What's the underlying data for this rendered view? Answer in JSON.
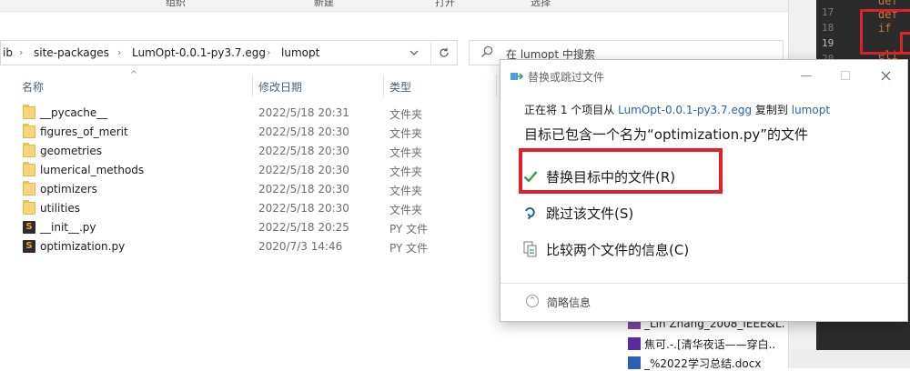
{
  "ribbon": {
    "items": [
      "组织",
      "新建",
      "打开",
      "选择"
    ]
  },
  "address": {
    "crumbs": [
      "ib",
      "site-packages",
      "LumOpt-0.0.1-py3.7.egg",
      "lumopt"
    ],
    "refresh_icon": "refresh-icon",
    "dropdown_icon": "chevron-down-icon"
  },
  "search": {
    "placeholder": "在 lumopt 中搜索",
    "icon": "search-icon"
  },
  "columns": {
    "name": "名称",
    "date": "修改日期",
    "type": "类型"
  },
  "files": [
    {
      "name": "__pycache__",
      "date": "2022/5/18 20:31",
      "type": "文件夹",
      "kind": "folder"
    },
    {
      "name": "figures_of_merit",
      "date": "2022/5/18 20:30",
      "type": "文件夹",
      "kind": "folder"
    },
    {
      "name": "geometries",
      "date": "2022/5/18 20:30",
      "type": "文件夹",
      "kind": "folder"
    },
    {
      "name": "lumerical_methods",
      "date": "2022/5/18 20:30",
      "type": "文件夹",
      "kind": "folder"
    },
    {
      "name": "optimizers",
      "date": "2022/5/18 20:30",
      "type": "文件夹",
      "kind": "folder"
    },
    {
      "name": "utilities",
      "date": "2022/5/18 20:30",
      "type": "文件夹",
      "kind": "folder"
    },
    {
      "name": "__init__.py",
      "date": "2022/5/18 20:25",
      "type": "PY 文件",
      "kind": "py"
    },
    {
      "name": "optimization.py",
      "date": "2020/7/3 14:46",
      "type": "PY 文件",
      "kind": "py"
    }
  ],
  "editor": {
    "lines": [
      "17",
      "18",
      "19",
      "20"
    ],
    "tokens": [
      "def",
      "def",
      "if",
      "eli"
    ]
  },
  "background_list": [
    "_Lin Zhang_2008_IEEE&L.",
    "焦可.-.[清华夜话——穿白..",
    "_%2022学习总结.docx"
  ],
  "dialog": {
    "title": "替换或跳过文件",
    "info_prefix": "正在将 1 个项目从",
    "info_source": "LumOpt-0.0.1-py3.7.egg",
    "info_mid": "复制到",
    "info_dest": "lumopt",
    "heading": "目标已包含一个名为“optimization.py”的文件",
    "options": {
      "replace": "替换目标中的文件(R)",
      "skip": "跳过该文件(S)",
      "compare": "比较两个文件的信息(C)"
    },
    "footer": "简略信息",
    "accent_red": "#e0202a",
    "link_color": "#2a62a8"
  }
}
